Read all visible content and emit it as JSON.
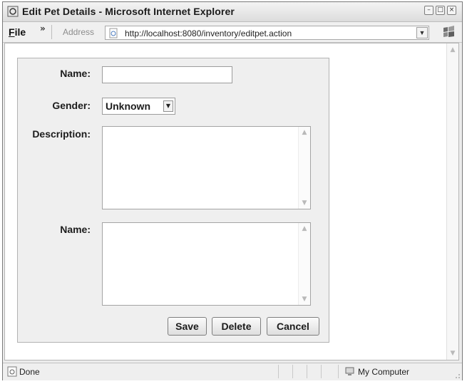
{
  "window": {
    "title": "Edit Pet Details - Microsoft Internet Explorer",
    "buttons": {
      "minimize_icon": "minimize-icon",
      "maximize_icon": "maximize-icon",
      "close_icon": "close-icon"
    }
  },
  "menubar": {
    "file_label": "File",
    "chevron": "»",
    "address_label": "Address",
    "address_value": "http://localhost:8080/inventory/editpet.action"
  },
  "form": {
    "name_label": "Name:",
    "name_value": "",
    "gender_label": "Gender:",
    "gender_selected": "Unknown",
    "description_label": "Description:",
    "description_value": "",
    "name2_label": "Name:",
    "name2_value": "",
    "save_label": "Save",
    "delete_label": "Delete",
    "cancel_label": "Cancel"
  },
  "statusbar": {
    "status_text": "Done",
    "zone_text": "My Computer"
  },
  "colors": {
    "accent": "#efefef",
    "window_bg": "#ececec"
  }
}
